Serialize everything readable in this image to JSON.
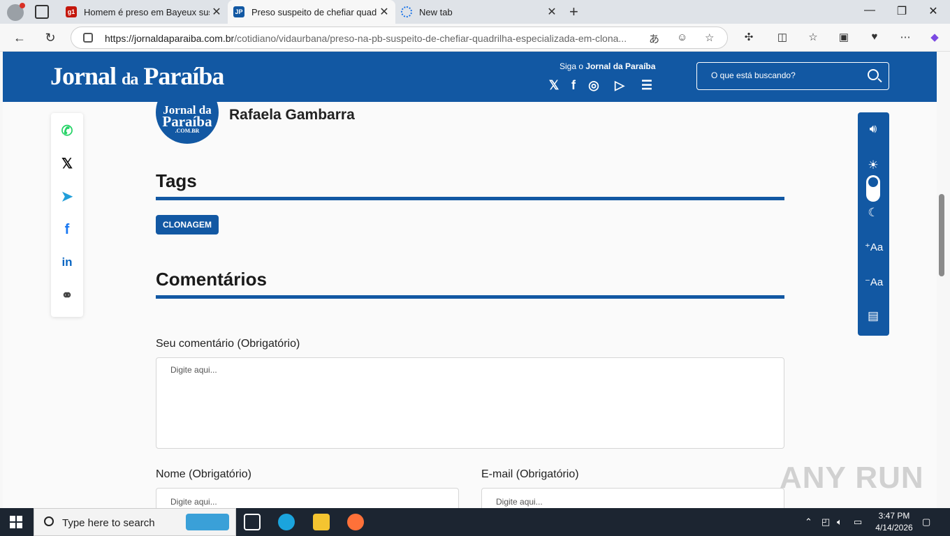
{
  "browser": {
    "tabs": [
      {
        "title": "Homem é preso em Bayeux suspe",
        "favicon": "g1",
        "favicon_color": "#c4170c"
      },
      {
        "title": "Preso suspeito de chefiar quadrilh",
        "favicon": "jp",
        "favicon_color": "#1258a3"
      },
      {
        "title": "New tab",
        "favicon": "loading",
        "favicon_color": "#1a73e8"
      }
    ],
    "url_host": "https://jornaldaparaiba.com.br",
    "url_path": "/cotidiano/vidaurbana/preso-na-pb-suspeito-de-chefiar-quadrilha-especializada-em-clona..."
  },
  "header": {
    "logo_main": "Jornal",
    "logo_da": "da",
    "logo_end": "Paraíba",
    "follow_prefix": "Siga o ",
    "follow_brand": "Jornal da Paraíba",
    "search_placeholder": "O que está buscando?",
    "brand_color": "#1258a3"
  },
  "author": {
    "logo_line1": "Jornal da",
    "logo_line2": "Paraíba",
    "logo_line3": ".COM.BR",
    "name": "Rafaela Gambarra"
  },
  "tags": {
    "heading": "Tags",
    "items": [
      "CLONAGEM"
    ]
  },
  "comments": {
    "heading": "Comentários",
    "comment_label": "Seu comentário (Obrigatório)",
    "comment_placeholder": "Digite aqui...",
    "name_label": "Nome (Obrigatório)",
    "name_placeholder": "Digite aqui...",
    "email_label": "E-mail (Obrigatório)",
    "email_placeholder": "Digite aqui..."
  },
  "share": [
    "whatsapp-icon",
    "x-icon",
    "telegram-icon",
    "facebook-icon",
    "linkedin-icon",
    "link-icon"
  ],
  "accessibility": [
    "speaker-icon",
    "sun-icon",
    "theme-toggle",
    "moon-icon",
    "font-increase-icon",
    "font-decrease-icon",
    "comment-icon"
  ],
  "taskbar": {
    "search_text": "Type here to search",
    "time": "3:47 PM",
    "date": "4/14/2026"
  },
  "watermark": "ANY RUN"
}
